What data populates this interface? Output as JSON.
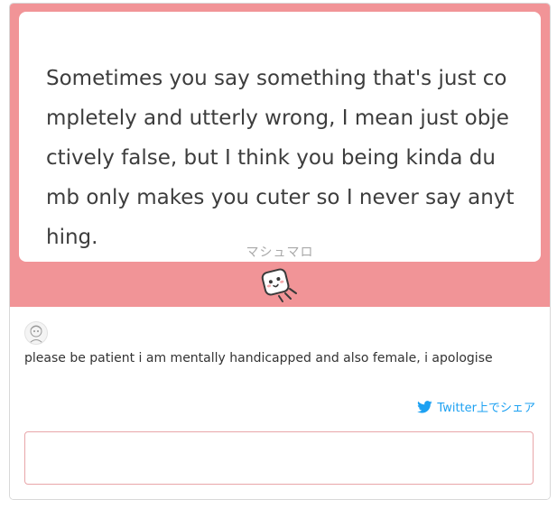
{
  "message": {
    "text": "Sometimes you say something that's just completely and utterly wrong, I mean just objectively false, but I think you being kinda dumb only makes you cuter so I never say anything.",
    "brand_label": "マシュマロ"
  },
  "mascot": {
    "icon": "marshmallow-mascot-icon"
  },
  "answer": {
    "avatar_icon": "avatar-icon",
    "text": "please be patient i am mentally handicapped and also female, i apologise"
  },
  "share": {
    "label": "Twitter上でシェア",
    "icon": "twitter-bird-icon"
  },
  "reply": {
    "value": "",
    "placeholder": ""
  },
  "colors": {
    "band": "#f19497",
    "twitter": "#1da1f2",
    "input_border": "#e8a6a9"
  }
}
